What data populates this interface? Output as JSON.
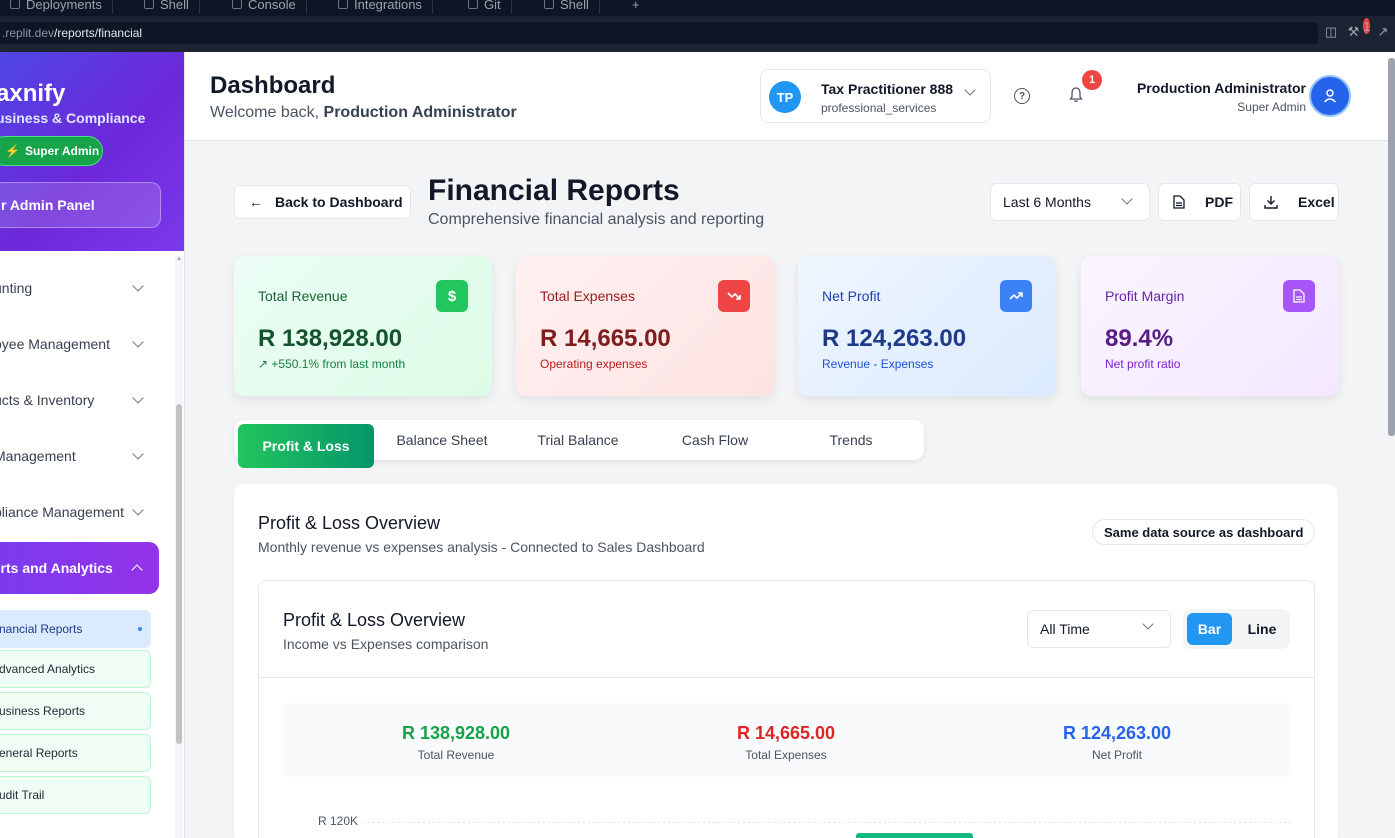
{
  "browser": {
    "tabs": [
      "Deployments",
      "Shell",
      "Console",
      "Integrations",
      "Git",
      "Shell"
    ],
    "new_tab": "+",
    "url_prefix": ".replit.dev",
    "url_path": "/reports/financial",
    "notification_count": "1"
  },
  "sidebar": {
    "brand": "axnify",
    "brand_subtitle": "usiness & Compliance",
    "role_badge": "Super Admin",
    "admin_panel": "r Admin Panel",
    "items": [
      {
        "label": "unting"
      },
      {
        "label": "oyee Management"
      },
      {
        "label": "ucts & Inventory"
      },
      {
        "label": "Management"
      },
      {
        "label": "pliance Management"
      },
      {
        "label": "orts and Analytics"
      }
    ],
    "sub_items": [
      {
        "label": "nancial Reports"
      },
      {
        "label": "dvanced Analytics"
      },
      {
        "label": "usiness Reports"
      },
      {
        "label": "eneral Reports"
      },
      {
        "label": "udit Trail"
      }
    ]
  },
  "header": {
    "title": "Dashboard",
    "welcome_prefix": "Welcome back, ",
    "welcome_name": "Production Administrator",
    "practitioner": {
      "initials": "TP",
      "name": "Tax Practitioner 888",
      "type": "professional_services"
    },
    "notification_count": "1",
    "help_glyph": "?",
    "user": {
      "name": "Production Administrator",
      "role": "Super Admin"
    }
  },
  "main": {
    "back_label": "Back to Dashboard",
    "title": "Financial Reports",
    "subtitle": "Comprehensive financial analysis and reporting",
    "period": "Last 6 Months",
    "pdf_label": "PDF",
    "excel_label": "Excel",
    "kpis": [
      {
        "label": "Total Revenue",
        "value": "R 138,928.00",
        "note": "+550.1% from last month",
        "icon": "dollar-icon",
        "glyph": "$"
      },
      {
        "label": "Total Expenses",
        "value": "R 14,665.00",
        "note": "Operating expenses",
        "icon": "trending-down-icon"
      },
      {
        "label": "Net Profit",
        "value": "R 124,263.00",
        "note": "Revenue - Expenses",
        "icon": "trending-up-icon"
      },
      {
        "label": "Profit Margin",
        "value": "89.4%",
        "note": "Net profit ratio",
        "icon": "document-icon"
      }
    ],
    "tabs": [
      "Profit & Loss",
      "Balance Sheet",
      "Trial Balance",
      "Cash Flow",
      "Trends"
    ],
    "panel": {
      "title": "Profit & Loss Overview",
      "subtitle": "Monthly revenue vs expenses analysis - Connected to Sales Dashboard",
      "badge": "Same data source as dashboard",
      "inner": {
        "title": "Profit & Loss Overview",
        "subtitle": "Income vs Expenses comparison",
        "time_filter": "All Time",
        "chart_types": [
          "Bar",
          "Line"
        ],
        "summary": [
          {
            "value": "R 138,928.00",
            "label": "Total Revenue",
            "color": "#16a34a"
          },
          {
            "value": "R 14,665.00",
            "label": "Total Expenses",
            "color": "#dc2626"
          },
          {
            "value": "R 124,263.00",
            "label": "Net Profit",
            "color": "#2563eb"
          }
        ],
        "y_tick": "R 120K"
      }
    }
  },
  "colors": {
    "accent_green": "#22c55e",
    "accent_purple": "#7c3aed",
    "accent_blue": "#2196f3"
  }
}
